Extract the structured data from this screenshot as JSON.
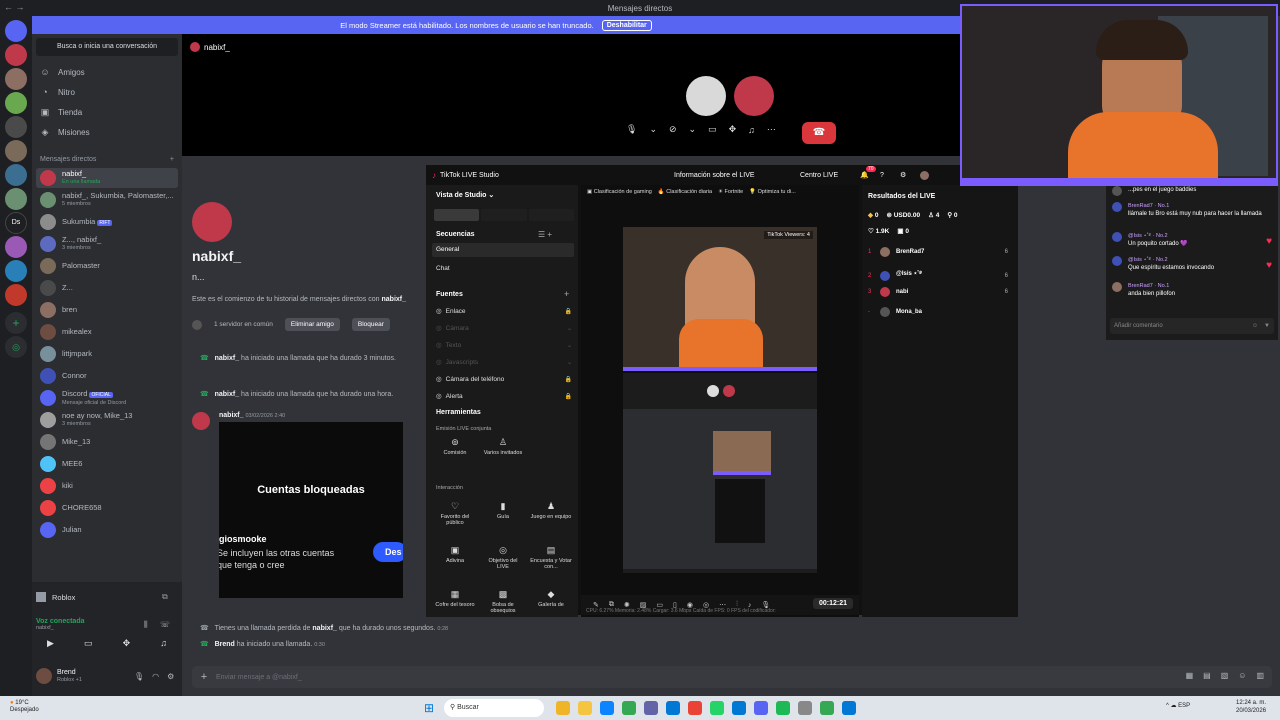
{
  "window": {
    "title": "Mensajes directos"
  },
  "banner": {
    "text": "El modo Streamer está habilitado. Los nombres de usuario se han truncado.",
    "button": "Deshabilitar"
  },
  "dm_sidebar": {
    "search_placeholder": "Busca o inicia una conversación",
    "nav": [
      {
        "label": "Amigos"
      },
      {
        "label": "Nitro"
      },
      {
        "label": "Tienda"
      },
      {
        "label": "Misiones"
      }
    ],
    "dm_header": "Mensajes directos",
    "dms": [
      {
        "name": "nabixf_",
        "sub": "En una llamada",
        "color": "#c0394b"
      },
      {
        "name": "nabixf_, Sukumbia, Palomaster,...",
        "sub": "5 miembros",
        "color": "#6b8f71"
      },
      {
        "name": "Sukumbia",
        "sub": "",
        "badge": "RIFT",
        "color": "#8c8c8c"
      },
      {
        "name": "Z..., nabixf_",
        "sub": "3 miembros",
        "color": "#5c6bc0"
      },
      {
        "name": "Palomaster",
        "sub": "",
        "color": "#7a6a5a"
      },
      {
        "name": "Z...",
        "sub": "",
        "color": "#4a4a4a"
      },
      {
        "name": "bren",
        "sub": "",
        "color": "#8d6e63"
      },
      {
        "name": "mikealex",
        "sub": "",
        "color": "#6d4c41"
      },
      {
        "name": "littjmpark",
        "sub": "",
        "color": "#78909c"
      },
      {
        "name": "Connor",
        "sub": "",
        "color": "#3f51b5"
      },
      {
        "name": "Discord",
        "sub": "Mensaje oficial de Discord",
        "badge": "OFICIAL",
        "color": "#5865f2"
      },
      {
        "name": "noe ay now, Mike_13",
        "sub": "3 miembros",
        "color": "#9e9e9e"
      },
      {
        "name": "Mike_13",
        "sub": "",
        "color": "#757575"
      },
      {
        "name": "MEE6",
        "sub": "",
        "color": "#4fc3f7"
      },
      {
        "name": "kiki",
        "sub": "",
        "color": "#ed4245"
      },
      {
        "name": "CHORE658",
        "sub": "",
        "color": "#ed4245"
      },
      {
        "name": "Julian",
        "sub": "",
        "color": "#5865f2"
      }
    ],
    "activity": "Roblox",
    "voice_status": "Voz conectada",
    "voice_sub": "nabixf_",
    "user_name": "Brend",
    "user_status": "Roblox +1"
  },
  "chat": {
    "header_name": "nabixf_",
    "profile_name": "nabixf_",
    "profile_sub": "n...",
    "intro_text": "Este es el comienzo de tu historial de mensajes directos con",
    "intro_name": "nabixf_",
    "common_servers": "1 servidor en común",
    "remove_friend": "Eliminar amigo",
    "block": "Bloquear",
    "calls": [
      {
        "user": "nabixf_",
        "text": "ha iniciado una llamada que ha durado 3 minutos."
      },
      {
        "user": "nabixf_",
        "text": "ha iniciado una llamada que ha durado una hora."
      }
    ],
    "last_author": "nabixf_",
    "last_time": "03/02/2026 2:40",
    "embed_title": "Cuentas bloqueadas",
    "embed_user": "giosmooke",
    "embed_line1": "Se incluyen las otras cuentas",
    "embed_line2": "que tenga o cree",
    "embed_btn": "Des",
    "missed_call": {
      "prefix": "Tienes una llamada perdida de",
      "user": "nabixf_",
      "suffix": "que ha durado unos segundos.",
      "time": "0:28"
    },
    "started_call": {
      "user": "Brend",
      "text": "ha iniciado una llamada.",
      "time": "0:30"
    },
    "input_placeholder": "Enviar mensaje a @nabixf_"
  },
  "tiktok": {
    "title": "TikTok LIVE Studio",
    "info": "Información sobre el LIVE",
    "center": "Centro LIVE",
    "notif_count": "70",
    "view": "Vista de Studio",
    "sequences": "Secuencias",
    "general": "General",
    "chat": "Chat",
    "sources": "Fuentes",
    "source_items": [
      {
        "label": "Enlace",
        "dim": false
      },
      {
        "label": "Cámara",
        "dim": true
      },
      {
        "label": "Texto",
        "dim": true
      },
      {
        "label": "Javascripts",
        "dim": true
      },
      {
        "label": "Cámara del teléfono",
        "dim": false
      },
      {
        "label": "Alerta",
        "dim": false
      }
    ],
    "tools": "Herramientas",
    "joint": "Emisión LIVE conjunta",
    "tiles_row1": [
      "Comisión",
      "Varios invitados"
    ],
    "interaction": "Interacción",
    "tiles_row2": [
      "Favorito del público",
      "Guía",
      "Juego en equipo"
    ],
    "tiles_row3": [
      "Adivina",
      "Objetivo del LIVE",
      "Encuesta y Votar con..."
    ],
    "tiles_row4": [
      "Cofre del tesoro",
      "Bolsa de obsequios",
      "Galería de"
    ],
    "chips": [
      "Clasificación de gaming",
      "Clasificación diaria",
      "Fortnite",
      "Optimiza tu di..."
    ],
    "viewers_label": "TikTok Viewers: 4",
    "timer": "00:12:21",
    "stats": "CPU: 6.27%    Memoria: 2.48%    Cargar: 3.6 Mbps    Caída de FPS: 0    FPS del codificador:",
    "results_title": "Resultados del LIVE",
    "stats_row1": [
      "0",
      "USD0.00",
      "4",
      "0"
    ],
    "stats_row2": [
      "1.9K",
      "0"
    ],
    "ranking": [
      {
        "rank": "1",
        "name": "BrenRad7",
        "score": "6"
      },
      {
        "rank": "2",
        "name": "@Isis ⋆˚࿔",
        "score": "6"
      },
      {
        "rank": "3",
        "name": "nabi",
        "score": "6"
      },
      {
        "rank": "-",
        "name": "Mona_ba",
        "score": ""
      }
    ]
  },
  "livechat": {
    "messages": [
      {
        "user": "",
        "text": "...pes en el juego baddies"
      },
      {
        "user": "BrenRad7 · No.1",
        "text": "llámale tu Bro está muy nub para hacer la llamada"
      },
      {
        "user": "@Isis ⋆˚࿔ · No.2",
        "text": "Un poquito cortado 💜"
      },
      {
        "user": "@Isis ⋆˚࿔ · No.2",
        "text": "Que espíritu estamos invocando"
      },
      {
        "user": "BrenRad7 · No.1",
        "text": "anda bien pillofon"
      }
    ],
    "input": "Añadir comentario"
  },
  "taskbar": {
    "weather": "19°C",
    "weather_sub": "Despejado",
    "search": "Buscar",
    "lang": "ESP",
    "time": "12:24 a. m.",
    "date": "20/03/2026"
  }
}
